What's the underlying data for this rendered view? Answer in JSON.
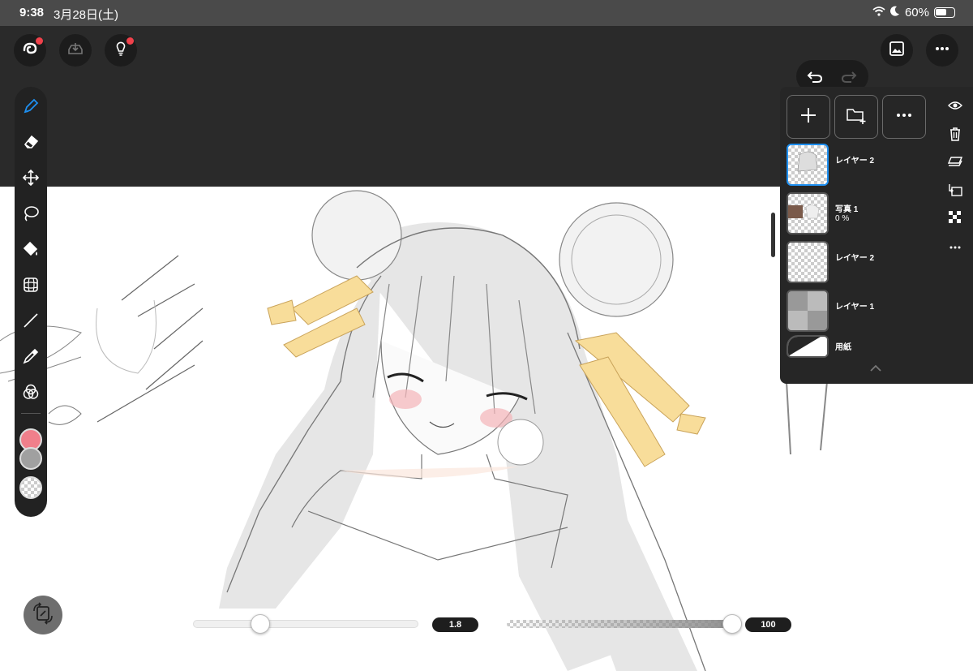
{
  "status_bar": {
    "time": "9:38",
    "date": "3月28日(土)",
    "battery": "60%",
    "battery_level": 0.6
  },
  "top_toolbar": {
    "buttons": [
      "app-menu-icon",
      "import-icon",
      "tips-icon",
      "undo-icon",
      "redo-icon",
      "gallery-icon",
      "more-icon"
    ]
  },
  "tools": [
    "pen-icon",
    "eraser-icon",
    "move-icon",
    "lasso-icon",
    "fill-icon",
    "transform-icon",
    "line-icon",
    "eyedropper-icon",
    "blend-icon"
  ],
  "colors": {
    "primary": "#f07f8b",
    "secondary": "#a0a0a0",
    "tertiary": "transparent",
    "accent": "#1e8ff0"
  },
  "layers": {
    "items": [
      {
        "name": "レイヤー 2",
        "sub": "",
        "selected": true
      },
      {
        "name": "写真 1",
        "sub": "0 %",
        "selected": false
      },
      {
        "name": "レイヤー 2",
        "sub": "",
        "selected": false
      },
      {
        "name": "レイヤー 1",
        "sub": "",
        "selected": false
      },
      {
        "name": "用紙",
        "sub": "",
        "selected": false
      }
    ]
  },
  "sliders": {
    "size": {
      "value": "1.8",
      "level": 0.3
    },
    "opacity": {
      "value": "100",
      "level": 1.0
    }
  }
}
